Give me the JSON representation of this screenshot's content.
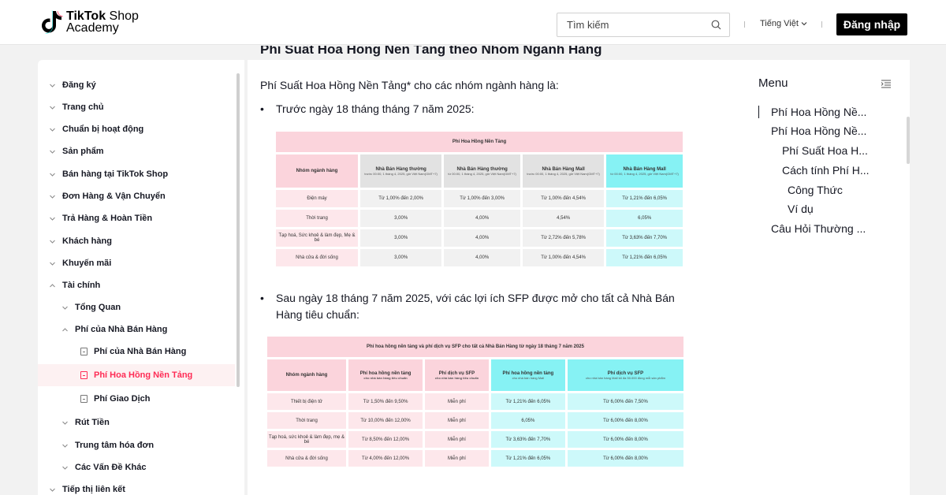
{
  "header": {
    "logo_line1_bold": "TikTok",
    "logo_line1_rest": " Shop",
    "logo_line2": "Academy",
    "search_placeholder": "Tìm kiếm",
    "language": "Tiếng Việt",
    "login_label": "Đăng nhập"
  },
  "sidebar": {
    "items": [
      {
        "label": "Đăng ký"
      },
      {
        "label": "Trang chủ"
      },
      {
        "label": "Chuẩn bị hoạt động"
      },
      {
        "label": "Sản phẩm"
      },
      {
        "label": "Bán hàng tại TikTok Shop"
      },
      {
        "label": "Đơn Hàng & Vận Chuyển"
      },
      {
        "label": "Trả Hàng & Hoàn Tiền"
      },
      {
        "label": "Khách hàng"
      },
      {
        "label": "Khuyến mãi"
      },
      {
        "label": "Tài chính"
      },
      {
        "label": "Tổng Quan"
      },
      {
        "label": "Phí của Nhà Bán Hàng"
      },
      {
        "label": "Phí của Nhà Bán Hàng"
      },
      {
        "label": "Phí Hoa Hồng Nền Tảng"
      },
      {
        "label": "Phí Giao Dịch"
      },
      {
        "label": "Rút Tiền"
      },
      {
        "label": "Trung tâm hóa đơn"
      },
      {
        "label": "Các Vấn Đề Khác"
      },
      {
        "label": "Tiếp thị liên kết"
      }
    ]
  },
  "content": {
    "clipped_heading": "Phí Suất Hoa Hồng Nền Tảng theo Nhóm Ngành Hàng",
    "intro": "Phí Suất Hoa Hồng Nền Tảng* cho các nhóm ngành hàng là:",
    "bullet1": "Trước ngày 18 tháng tháng 7 năm 2025:",
    "bullet2": "Sau ngày 18 tháng 7 năm 2025, với các lợi ích SFP được mở cho tất cả Nhà Bán Hàng tiêu chuẩn:"
  },
  "table1": {
    "banner": "Phí Hoa Hồng Nền Tảng",
    "first_header": "Nhóm ngành hàng",
    "headers": [
      {
        "title": "Nhà Bán Hàng thường",
        "sub": "trước 00:00, 1 tháng 4, 2025, giờ Việt Nam(GMT+7)"
      },
      {
        "title": "Nhà Bán Hàng thường",
        "sub": "từ 00:00, 1 tháng 4, 2025, giờ Việt Nam(GMT+7)"
      },
      {
        "title": "Nhà Bán Hàng Mall",
        "sub": "trước 00:00, 1 tháng 4, 2025, giờ Việt Nam(GMT+7)"
      },
      {
        "title": "Nhà Bán Hàng Mall",
        "sub": "từ 00:00, 1 tháng 4, 2025, giờ Việt Nam(GMT+7)"
      }
    ],
    "rows": [
      [
        "Điện máy",
        "Từ 1,00% đến 2,00%",
        "Từ 1,00% đến 3,00%",
        "Từ 1,00% đến 4,54%",
        "Từ 1,21% đến 6,05%"
      ],
      [
        "Thời trang",
        "3,00%",
        "4,00%",
        "4,54%",
        "6,05%"
      ],
      [
        "Tạp hoá, Sức khoẻ & làm đẹp, Mẹ & bé",
        "3,00%",
        "4,00%",
        "Từ 2,72% đến 5,78%",
        "Từ 3,63% đến 7,70%"
      ],
      [
        "Nhà cửa & đời sống",
        "3,00%",
        "4,00%",
        "Từ 1,00% đến 4,54%",
        "Từ 1,21% đến 6,05%"
      ]
    ]
  },
  "table2": {
    "banner": "Phí hoa hồng nền tảng và phí dịch vụ SFP cho tất cả Nhà Bán Hàng từ ngày 18 tháng 7 năm 2025",
    "first_header": "Nhóm ngành hàng",
    "headers": [
      {
        "title": "Phí hoa hồng nền tảng",
        "sub": "cho nhà bán hàng tiêu chuẩn"
      },
      {
        "title": "Phí dịch vụ SFP",
        "sub": "cho nhà bán hàng tiêu chuẩn"
      },
      {
        "title": "Phí hoa hồng nền tảng",
        "sub": "cho nhà bán hàng Mall"
      },
      {
        "title": "Phí dịch vụ SFP",
        "sub": "cho nhà bán hàng Mall tối đa 50.000 đồng mỗi sản phẩm"
      }
    ],
    "rows": [
      [
        "Thiết bị điện tử",
        "Từ 1,50% đến 9,50%",
        "Miễn phí",
        "Từ 1,21% đến 6,05%",
        "Từ 6,00% đến 7,50%"
      ],
      [
        "Thời trang",
        "Từ 10,00% đến 12,00%",
        "Miễn phí",
        "6,05%",
        "Từ 6,00% đến 8,00%"
      ],
      [
        "Tạp hoá, sức khoẻ & làm đẹp, mẹ & bé",
        "Từ 8,50% đến 12,00%",
        "Miễn phí",
        "Từ 3,63% đến 7,70%",
        "Từ 6,00% đến 8,00%"
      ],
      [
        "Nhà cửa & đời sống",
        "Từ 4,00% đến 12,00%",
        "Miễn phí",
        "Từ 1,21% đến 6,05%",
        "Từ 6,00% đến 8,00%"
      ]
    ]
  },
  "toc": {
    "title": "Menu",
    "items": [
      {
        "label": "Phí Hoa Hồng Nề..."
      },
      {
        "label": "Phí Hoa Hồng Nề..."
      },
      {
        "label": "Phí Suất Hoa H..."
      },
      {
        "label": "Cách tính Phí H..."
      },
      {
        "label": "Công Thức"
      },
      {
        "label": "Ví dụ"
      },
      {
        "label": "Câu Hỏi Thường ..."
      }
    ]
  }
}
